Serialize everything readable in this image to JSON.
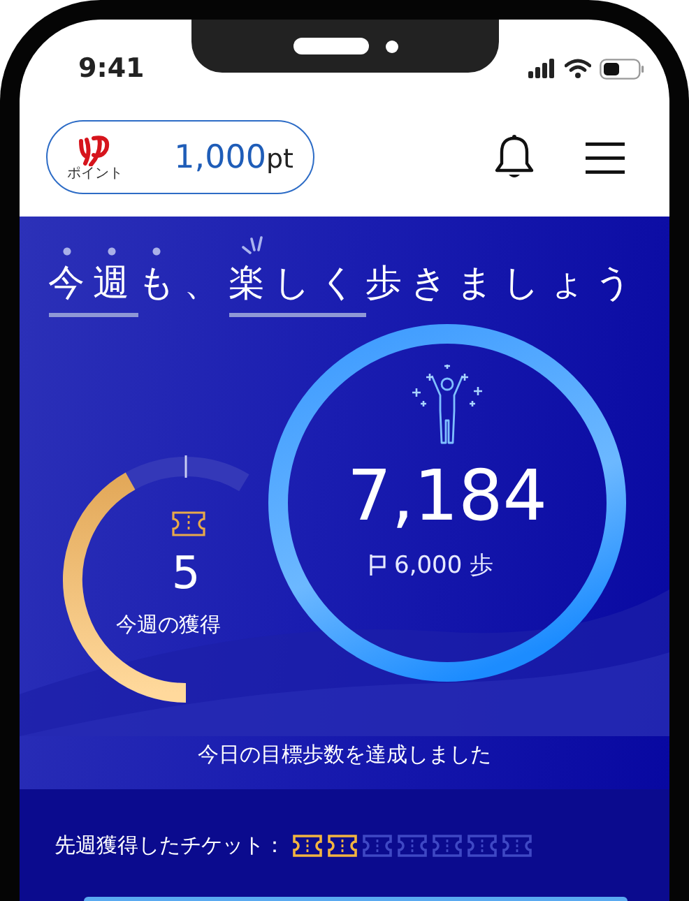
{
  "status_bar": {
    "time": "9:41"
  },
  "header": {
    "brand_caption": "ポイント",
    "points": "1,000",
    "points_unit": "pt"
  },
  "banner": {
    "sparkle": true,
    "heading": [
      {
        "text": "今週",
        "dotted": true,
        "underlined": true
      },
      {
        "text": "も",
        "dotted": true,
        "underlined": false
      },
      {
        "text": "、",
        "dotted": false,
        "underlined": false
      },
      {
        "text": "楽しく",
        "dotted": false,
        "underlined": true
      },
      {
        "text": "歩きましょう",
        "dotted": false,
        "underlined": false
      }
    ]
  },
  "weekly": {
    "count": "5",
    "label": "今週の獲得"
  },
  "steps": {
    "count": "7,184",
    "goal": "6,000",
    "goal_unit": "歩"
  },
  "achievement": "今日の目標歩数を達成しました",
  "last_week": {
    "label": "先週獲得したチケット：",
    "tickets": [
      {
        "earned": true
      },
      {
        "earned": true
      },
      {
        "earned": false
      },
      {
        "earned": false
      },
      {
        "earned": false
      },
      {
        "earned": false
      },
      {
        "earned": false
      }
    ]
  }
}
